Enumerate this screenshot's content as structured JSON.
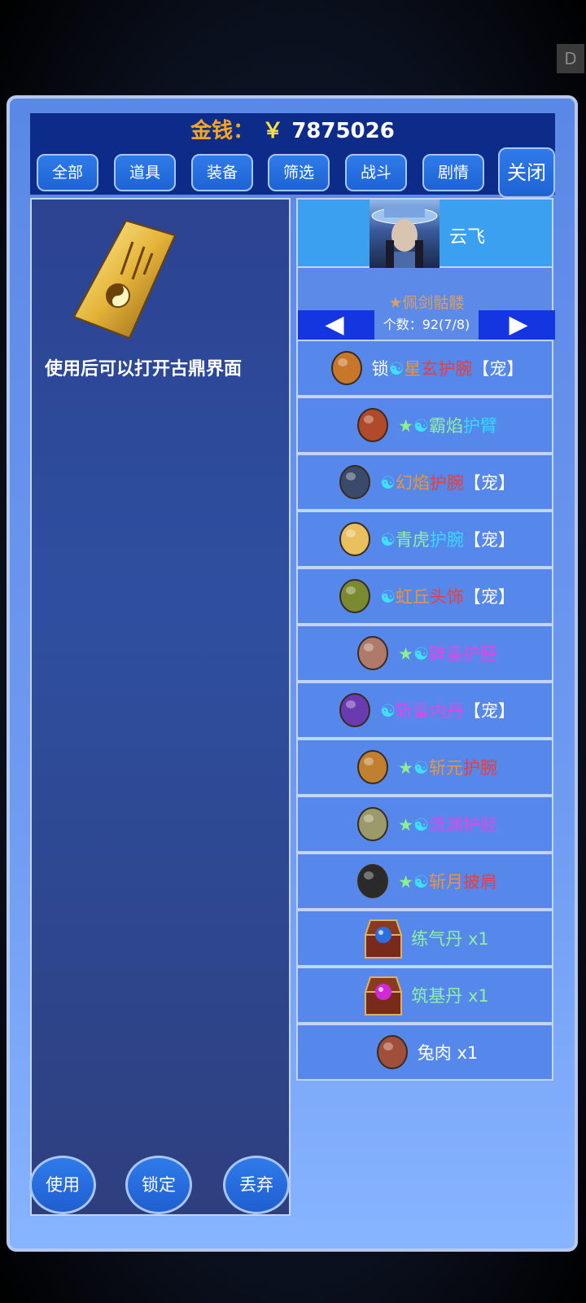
{
  "header": {
    "money_label": "金钱：",
    "money_symbol": "￥",
    "money_value": "7875026"
  },
  "corner_tag": "D",
  "tabs": [
    {
      "label": "全部"
    },
    {
      "label": "道具"
    },
    {
      "label": "装备"
    },
    {
      "label": "筛选"
    },
    {
      "label": "战斗"
    },
    {
      "label": "剧情"
    }
  ],
  "close_label": "关闭",
  "detail": {
    "description": "使用后可以打开古鼎界面"
  },
  "actions": {
    "use": "使用",
    "lock": "锁定",
    "discard": "丢弃"
  },
  "character": {
    "name": "云飞"
  },
  "pager": {
    "title": "★佩剑骷髅",
    "prev_glyph": "◀",
    "next_glyph": "▶",
    "count": "个数：92(7/8)"
  },
  "items": [
    {
      "parts": [
        {
          "t": "锁",
          "c": "c-white"
        },
        {
          "t": "☯",
          "c": "c-taiji"
        },
        {
          "t": "星",
          "c": "c-orange"
        },
        {
          "t": "玄",
          "c": "c-red"
        },
        {
          "t": "护腕",
          "c": "c-red"
        },
        {
          "t": "【宠】",
          "c": "c-white"
        }
      ],
      "icon": "bracer-icon"
    },
    {
      "parts": [
        {
          "t": "★",
          "c": "c-star"
        },
        {
          "t": "☯",
          "c": "c-taiji"
        },
        {
          "t": "霸焰",
          "c": "c-green"
        },
        {
          "t": "护臂",
          "c": "c-cyan"
        }
      ],
      "icon": "arm-guard-icon"
    },
    {
      "parts": [
        {
          "t": "☯",
          "c": "c-taiji"
        },
        {
          "t": "幻焰",
          "c": "c-orange"
        },
        {
          "t": "护腕",
          "c": "c-red"
        },
        {
          "t": "【宠】",
          "c": "c-white"
        }
      ],
      "icon": "gauntlet-icon"
    },
    {
      "parts": [
        {
          "t": "☯",
          "c": "c-taiji"
        },
        {
          "t": "青虎",
          "c": "c-green"
        },
        {
          "t": "护腕",
          "c": "c-cyan"
        },
        {
          "t": "【宠】",
          "c": "c-white"
        }
      ],
      "icon": "claw-icon"
    },
    {
      "parts": [
        {
          "t": "☯",
          "c": "c-taiji"
        },
        {
          "t": "虹丘",
          "c": "c-orange"
        },
        {
          "t": "头饰",
          "c": "c-red"
        },
        {
          "t": "【宠】",
          "c": "c-white"
        }
      ],
      "icon": "headdress-icon"
    },
    {
      "parts": [
        {
          "t": "★",
          "c": "c-star"
        },
        {
          "t": "☯",
          "c": "c-taiji"
        },
        {
          "t": "辟蛮护胫",
          "c": "c-magenta"
        }
      ],
      "icon": "greave-icon"
    },
    {
      "parts": [
        {
          "t": "☯",
          "c": "c-taiji"
        },
        {
          "t": "斩雷内丹",
          "c": "c-magenta"
        },
        {
          "t": "【宠】",
          "c": "c-white"
        }
      ],
      "icon": "orb-icon"
    },
    {
      "parts": [
        {
          "t": "★",
          "c": "c-star"
        },
        {
          "t": "☯",
          "c": "c-taiji"
        },
        {
          "t": "斩元",
          "c": "c-orange"
        },
        {
          "t": "护腕",
          "c": "c-red"
        }
      ],
      "icon": "wristband-icon"
    },
    {
      "parts": [
        {
          "t": "★",
          "c": "c-star"
        },
        {
          "t": "☯",
          "c": "c-taiji"
        },
        {
          "t": "流渊护胫",
          "c": "c-magenta"
        }
      ],
      "icon": "shin-guard-icon"
    },
    {
      "parts": [
        {
          "t": "★",
          "c": "c-star"
        },
        {
          "t": "☯",
          "c": "c-taiji"
        },
        {
          "t": "斩月",
          "c": "c-orange"
        },
        {
          "t": "披肩",
          "c": "c-red"
        }
      ],
      "icon": "skull-cape-icon"
    },
    {
      "parts": [
        {
          "t": "练气丹 x1",
          "c": "c-green",
          "w": true
        }
      ],
      "icon": "blue-pill-chest-icon",
      "orb": "#2a6fe0"
    },
    {
      "parts": [
        {
          "t": "筑基丹 x1",
          "c": "c-green",
          "w": true
        }
      ],
      "icon": "purple-pill-chest-icon",
      "orb": "#d02ad6"
    },
    {
      "parts": [
        {
          "t": "兔肉 x1",
          "c": "c-white"
        }
      ],
      "icon": "rabbit-meat-icon"
    }
  ]
}
